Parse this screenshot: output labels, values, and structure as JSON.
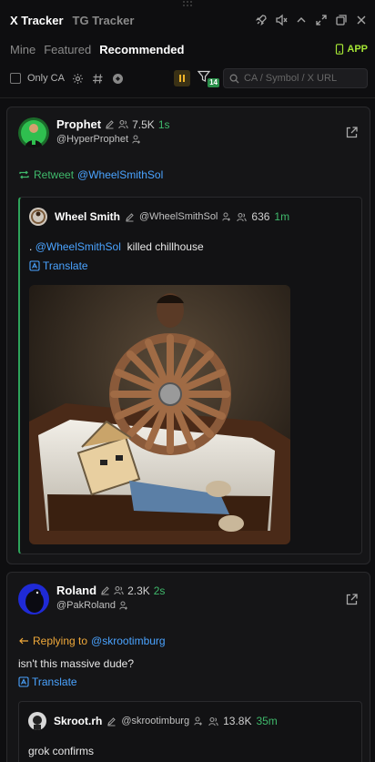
{
  "header": {
    "tabs": [
      "X Tracker",
      "TG Tracker"
    ],
    "subtabs": [
      "Mine",
      "Featured",
      "Recommended"
    ],
    "app_label": "APP"
  },
  "filters": {
    "only_ca_label": "Only CA",
    "filter_count": "14",
    "search_placeholder": "CA / Symbol / X URL"
  },
  "posts": [
    {
      "author": {
        "name": "Prophet",
        "handle": "@HyperProphet",
        "followers": "7.5K",
        "time": "1s"
      },
      "retweet": {
        "label": "Retweet",
        "user": "@WheelSmithSol"
      },
      "quote": {
        "author": {
          "name": "Wheel Smith",
          "handle": "@WheelSmithSol",
          "followers": "636",
          "time": "1m"
        },
        "text_prefix": ".",
        "mention": "@WheelSmithSol",
        "text_suffix": "killed chillhouse",
        "translate": "Translate"
      }
    },
    {
      "author": {
        "name": "Roland",
        "handle": "@PakRoland",
        "followers": "2.3K",
        "time": "2s"
      },
      "reply": {
        "label": "Replying to",
        "user": "@skrootimburg"
      },
      "text": "isn't this massive dude?",
      "translate": "Translate",
      "quote": {
        "author": {
          "name": "Skroot.rh",
          "handle": "@skrootimburg",
          "followers": "13.8K",
          "time": "35m"
        },
        "text": "grok confirms"
      }
    }
  ],
  "colors": {
    "accent_green": "#3fb96b",
    "link_blue": "#4aa3ff",
    "reply_orange": "#f0a93a",
    "app_green": "#a5e635"
  }
}
